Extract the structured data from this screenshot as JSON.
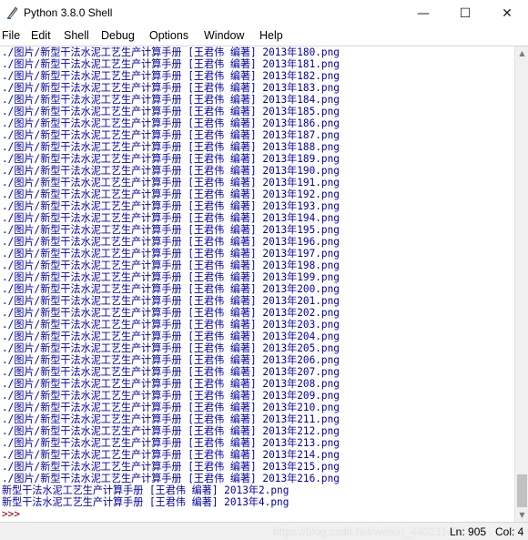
{
  "window": {
    "title": "Python 3.8.0 Shell",
    "minimize_glyph": "—",
    "maximize_glyph": "☐",
    "close_glyph": "✕"
  },
  "menu": [
    "File",
    "Edit",
    "Shell",
    "Debug",
    "Options",
    "Window",
    "Help"
  ],
  "output": {
    "lines": [
      "./图片/新型干法水泥工艺生产计算手册 [王君伟 编著] 2013年180.png",
      "./图片/新型干法水泥工艺生产计算手册 [王君伟 编著] 2013年181.png",
      "./图片/新型干法水泥工艺生产计算手册 [王君伟 编著] 2013年182.png",
      "./图片/新型干法水泥工艺生产计算手册 [王君伟 编著] 2013年183.png",
      "./图片/新型干法水泥工艺生产计算手册 [王君伟 编著] 2013年184.png",
      "./图片/新型干法水泥工艺生产计算手册 [王君伟 编著] 2013年185.png",
      "./图片/新型干法水泥工艺生产计算手册 [王君伟 编著] 2013年186.png",
      "./图片/新型干法水泥工艺生产计算手册 [王君伟 编著] 2013年187.png",
      "./图片/新型干法水泥工艺生产计算手册 [王君伟 编著] 2013年188.png",
      "./图片/新型干法水泥工艺生产计算手册 [王君伟 编著] 2013年189.png",
      "./图片/新型干法水泥工艺生产计算手册 [王君伟 编著] 2013年190.png",
      "./图片/新型干法水泥工艺生产计算手册 [王君伟 编著] 2013年191.png",
      "./图片/新型干法水泥工艺生产计算手册 [王君伟 编著] 2013年192.png",
      "./图片/新型干法水泥工艺生产计算手册 [王君伟 编著] 2013年193.png",
      "./图片/新型干法水泥工艺生产计算手册 [王君伟 编著] 2013年194.png",
      "./图片/新型干法水泥工艺生产计算手册 [王君伟 编著] 2013年195.png",
      "./图片/新型干法水泥工艺生产计算手册 [王君伟 编著] 2013年196.png",
      "./图片/新型干法水泥工艺生产计算手册 [王君伟 编著] 2013年197.png",
      "./图片/新型干法水泥工艺生产计算手册 [王君伟 编著] 2013年198.png",
      "./图片/新型干法水泥工艺生产计算手册 [王君伟 编著] 2013年199.png",
      "./图片/新型干法水泥工艺生产计算手册 [王君伟 编著] 2013年200.png",
      "./图片/新型干法水泥工艺生产计算手册 [王君伟 编著] 2013年201.png",
      "./图片/新型干法水泥工艺生产计算手册 [王君伟 编著] 2013年202.png",
      "./图片/新型干法水泥工艺生产计算手册 [王君伟 编著] 2013年203.png",
      "./图片/新型干法水泥工艺生产计算手册 [王君伟 编著] 2013年204.png",
      "./图片/新型干法水泥工艺生产计算手册 [王君伟 编著] 2013年205.png",
      "./图片/新型干法水泥工艺生产计算手册 [王君伟 编著] 2013年206.png",
      "./图片/新型干法水泥工艺生产计算手册 [王君伟 编著] 2013年207.png",
      "./图片/新型干法水泥工艺生产计算手册 [王君伟 编著] 2013年208.png",
      "./图片/新型干法水泥工艺生产计算手册 [王君伟 编著] 2013年209.png",
      "./图片/新型干法水泥工艺生产计算手册 [王君伟 编著] 2013年210.png",
      "./图片/新型干法水泥工艺生产计算手册 [王君伟 编著] 2013年211.png",
      "./图片/新型干法水泥工艺生产计算手册 [王君伟 编著] 2013年212.png",
      "./图片/新型干法水泥工艺生产计算手册 [王君伟 编著] 2013年213.png",
      "./图片/新型干法水泥工艺生产计算手册 [王君伟 编著] 2013年214.png",
      "./图片/新型干法水泥工艺生产计算手册 [王君伟 编著] 2013年215.png",
      "./图片/新型干法水泥工艺生产计算手册 [王君伟 编著] 2013年216.png",
      "新型干法水泥工艺生产计算手册 [王君伟 编著] 2013年2.png",
      "新型干法水泥工艺生产计算手册 [王君伟 编著] 2013年4.png"
    ],
    "prompt": ">>> "
  },
  "status": {
    "ln": "Ln: 905",
    "col": "Col: 4",
    "watermark": "https://blog.csdn.net/weixin_44023145"
  },
  "colors": {
    "output_text": "#0000aa",
    "prompt_text": "#8b0000"
  },
  "icons": {
    "app": "idle-feather-icon",
    "scroll_up": "scroll-up-arrow-icon",
    "scroll_down": "scroll-down-arrow-icon"
  }
}
